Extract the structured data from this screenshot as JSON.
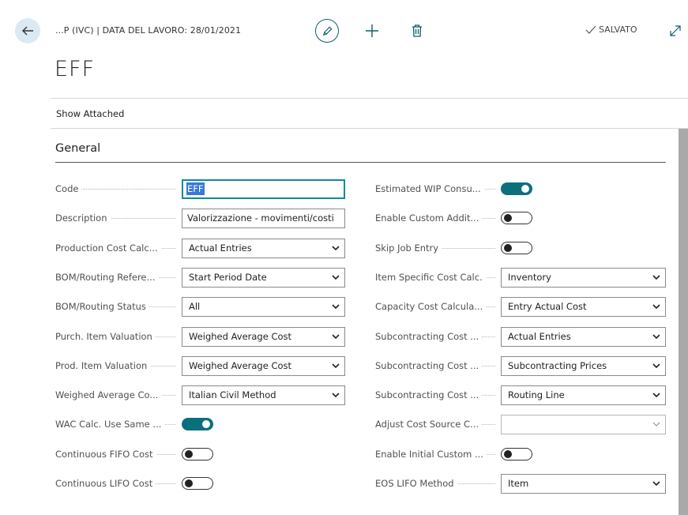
{
  "header": {
    "breadcrumb": "...P (IVC) | DATA DEL LAVORO: 28/01/2021",
    "saved_label": "SALVATO"
  },
  "page": {
    "title": "EFF"
  },
  "actions": {
    "show_attached": "Show Attached"
  },
  "section": {
    "title": "General"
  },
  "left_fields": [
    {
      "label": "Code",
      "type": "text",
      "value": "EFF"
    },
    {
      "label": "Description",
      "type": "text",
      "value": "Valorizzazione - movimenti/costi"
    },
    {
      "label": "Production Cost Calc...",
      "type": "select",
      "value": "Actual Entries"
    },
    {
      "label": "BOM/Routing Refere...",
      "type": "select",
      "value": "Start Period Date"
    },
    {
      "label": "BOM/Routing Status",
      "type": "select",
      "value": "All"
    },
    {
      "label": "Purch. Item Valuation",
      "type": "select",
      "value": "Weighed Average Cost"
    },
    {
      "label": "Prod. Item Valuation",
      "type": "select",
      "value": "Weighed Average Cost"
    },
    {
      "label": "Weighed Average Co...",
      "type": "select",
      "value": "Italian Civil Method"
    },
    {
      "label": "WAC Calc. Use Same ...",
      "type": "toggle",
      "value": "on"
    },
    {
      "label": "Continuous FIFO Cost",
      "type": "toggle",
      "value": "off"
    },
    {
      "label": "Continuous LIFO Cost",
      "type": "toggle",
      "value": "off"
    }
  ],
  "right_fields": [
    {
      "label": "Estimated WIP Consu...",
      "type": "toggle",
      "value": "on"
    },
    {
      "label": "Enable Custom Addit...",
      "type": "toggle",
      "value": "off"
    },
    {
      "label": "Skip Job Entry",
      "type": "toggle",
      "value": "off"
    },
    {
      "label": "Item Specific Cost Calc.",
      "type": "select",
      "value": "Inventory"
    },
    {
      "label": "Capacity Cost Calcula...",
      "type": "select",
      "value": "Entry Actual Cost"
    },
    {
      "label": "Subcontracting Cost ...",
      "type": "select",
      "value": "Actual Entries"
    },
    {
      "label": "Subcontracting Cost ...",
      "type": "select",
      "value": "Subcontracting Prices"
    },
    {
      "label": "Subcontracting Cost ...",
      "type": "select",
      "value": "Routing Line"
    },
    {
      "label": "Adjust Cost Source C...",
      "type": "select-empty",
      "value": ""
    },
    {
      "label": "Enable Initial Custom ...",
      "type": "toggle",
      "value": "off"
    },
    {
      "label": "EOS LIFO Method",
      "type": "select",
      "value": "Item"
    }
  ],
  "colors": {
    "accent": "#0b6f7d",
    "focus": "#0d8a9c",
    "back_button_bg": "#dbe9f3"
  },
  "icons": {
    "back": "arrow-left-icon",
    "edit": "pencil-icon",
    "new": "plus-icon",
    "delete": "trash-icon",
    "saved": "checkmark-icon",
    "expand": "expand-icon",
    "dropdown": "chevron-down-icon"
  }
}
